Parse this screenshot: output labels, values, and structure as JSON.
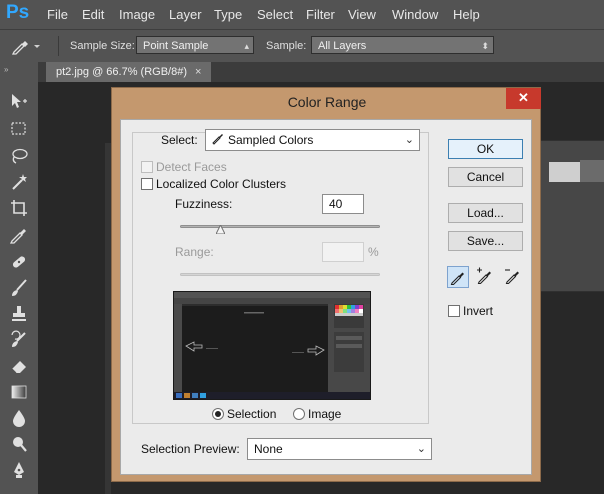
{
  "app": {
    "logo": "Ps",
    "menu": [
      "File",
      "Edit",
      "Image",
      "Layer",
      "Type",
      "Select",
      "Filter",
      "View",
      "Window",
      "Help"
    ]
  },
  "options_bar": {
    "tool_icon": "eyedropper-icon",
    "sample_size_label": "Sample Size:",
    "sample_size_value": "Point Sample",
    "sample_label": "Sample:",
    "sample_value": "All Layers"
  },
  "document": {
    "tab_title": "pt2.jpg @ 66.7% (RGB/8#)",
    "tab_close": "×"
  },
  "toolbar": {
    "tools": [
      "move-tool-icon",
      "marquee-tool-icon",
      "lasso-tool-icon",
      "magic-wand-icon",
      "crop-tool-icon",
      "eyedropper-tool-icon",
      "healing-brush-icon",
      "brush-tool-icon",
      "clone-stamp-icon",
      "history-brush-icon",
      "eraser-icon",
      "gradient-tool-icon",
      "blur-tool-icon",
      "dodge-tool-icon",
      "pen-tool-icon"
    ]
  },
  "dialog": {
    "title": "Color Range",
    "close": "✕",
    "select_label": "Select:",
    "select_value": "Sampled Colors",
    "detect_faces_label": "Detect Faces",
    "detect_faces_checked": false,
    "detect_faces_enabled": false,
    "localized_label": "Localized Color Clusters",
    "localized_checked": false,
    "fuzziness_label": "Fuzziness:",
    "fuzziness_value": "40",
    "fuzziness_fraction": 0.2,
    "range_label": "Range:",
    "range_value": "",
    "range_unit": "%",
    "preview_mode_selection_label": "Selection",
    "preview_mode_image_label": "Image",
    "preview_mode_selected": "selection",
    "selection_preview_label": "Selection Preview:",
    "selection_preview_value": "None",
    "buttons": {
      "ok": "OK",
      "cancel": "Cancel",
      "load": "Load...",
      "save": "Save..."
    },
    "eyedroppers": [
      "eyedropper-icon",
      "eyedropper-plus-icon",
      "eyedropper-minus-icon"
    ],
    "eyedropper_active": 0,
    "invert_label": "Invert",
    "invert_checked": false
  },
  "colors": {
    "ps_blue": "#31a8ff",
    "dialog_frame": "#c4986e",
    "close_red": "#c7392c"
  }
}
